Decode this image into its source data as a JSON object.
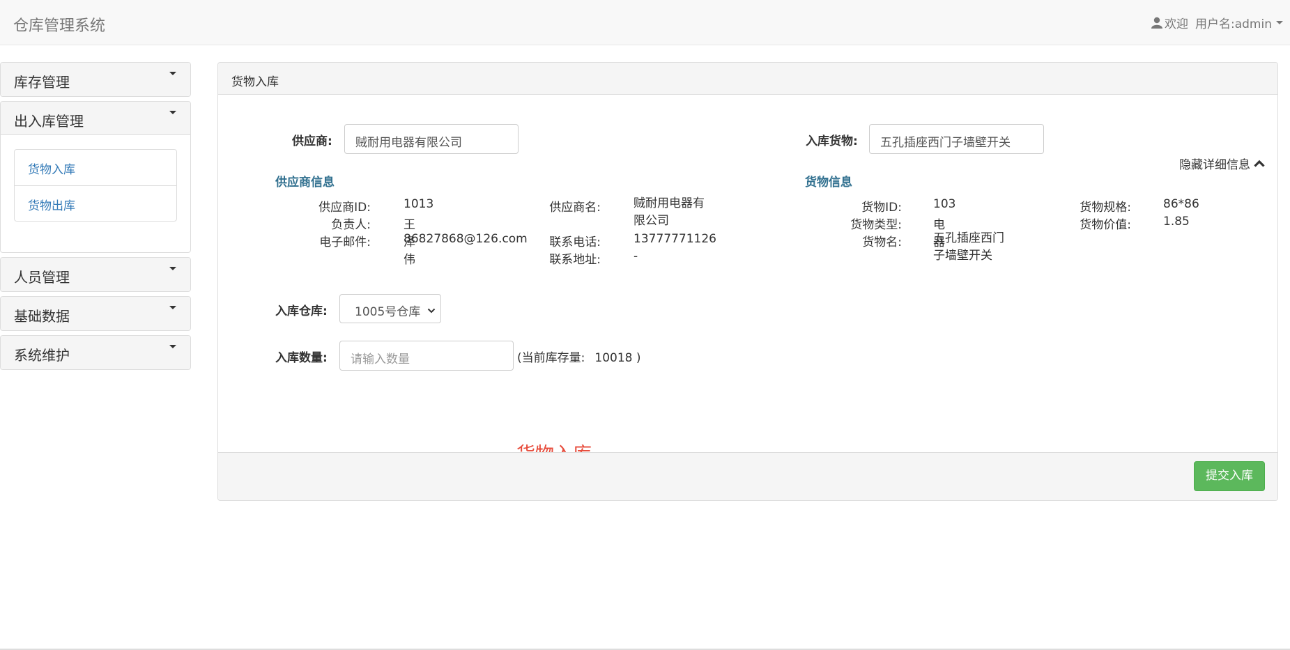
{
  "app": {
    "title": "仓库管理系统"
  },
  "user_menu": {
    "welcome": "欢迎",
    "username": "用户名:admin"
  },
  "sidebar": {
    "sections": [
      {
        "label": "库存管理"
      },
      {
        "label": "出入库管理",
        "items": [
          {
            "label": "货物入库"
          },
          {
            "label": "货物出库"
          }
        ]
      },
      {
        "label": "人员管理"
      },
      {
        "label": "基础数据"
      },
      {
        "label": "系统维护"
      }
    ]
  },
  "main": {
    "heading": "货物入库",
    "supplier_label": "供应商:",
    "supplier_value": "贼耐用电器有限公司",
    "goods_label": "入库货物:",
    "goods_value": "五孔插座西门子墙壁开关",
    "toggle_label": "隐藏详细信息",
    "supplier_info": {
      "title": "供应商信息",
      "id_label": "供应商ID:",
      "id_value": "1013",
      "name_label": "供应商名:",
      "name_value": "贼耐用电器有限公司",
      "contact_label": "负责人:",
      "contact_value": "王泽伟",
      "email_label": "电子邮件:",
      "email_value": "86827868@126.com",
      "phone_label": "联系电话:",
      "phone_value": "13777771126",
      "address_label": "联系地址:",
      "address_value": "-"
    },
    "goods_info": {
      "title": "货物信息",
      "id_label": "货物ID:",
      "id_value": "103",
      "spec_label": "货物规格:",
      "spec_value": "86*86",
      "type_label": "货物类型:",
      "type_value": "电器",
      "price_label": "货物价值:",
      "price_value": "1.85",
      "name_label": "货物名:",
      "name_value": "五孔插座西门子墙壁开关"
    },
    "warehouse_label": "入库仓库:",
    "warehouse_value": "1005号仓库",
    "quantity_label": "入库数量:",
    "quantity_placeholder": "请输入数量",
    "stock_prefix": "(当前库存量:",
    "stock_value": "10018",
    "stock_suffix": ")",
    "overlay_title": "货物入库",
    "submit_label": "提交入库"
  },
  "colors": {
    "accent": "#337ab7",
    "success": "#5cb85c",
    "section_title": "#31708f",
    "overlay_red": "#e74c3c"
  }
}
